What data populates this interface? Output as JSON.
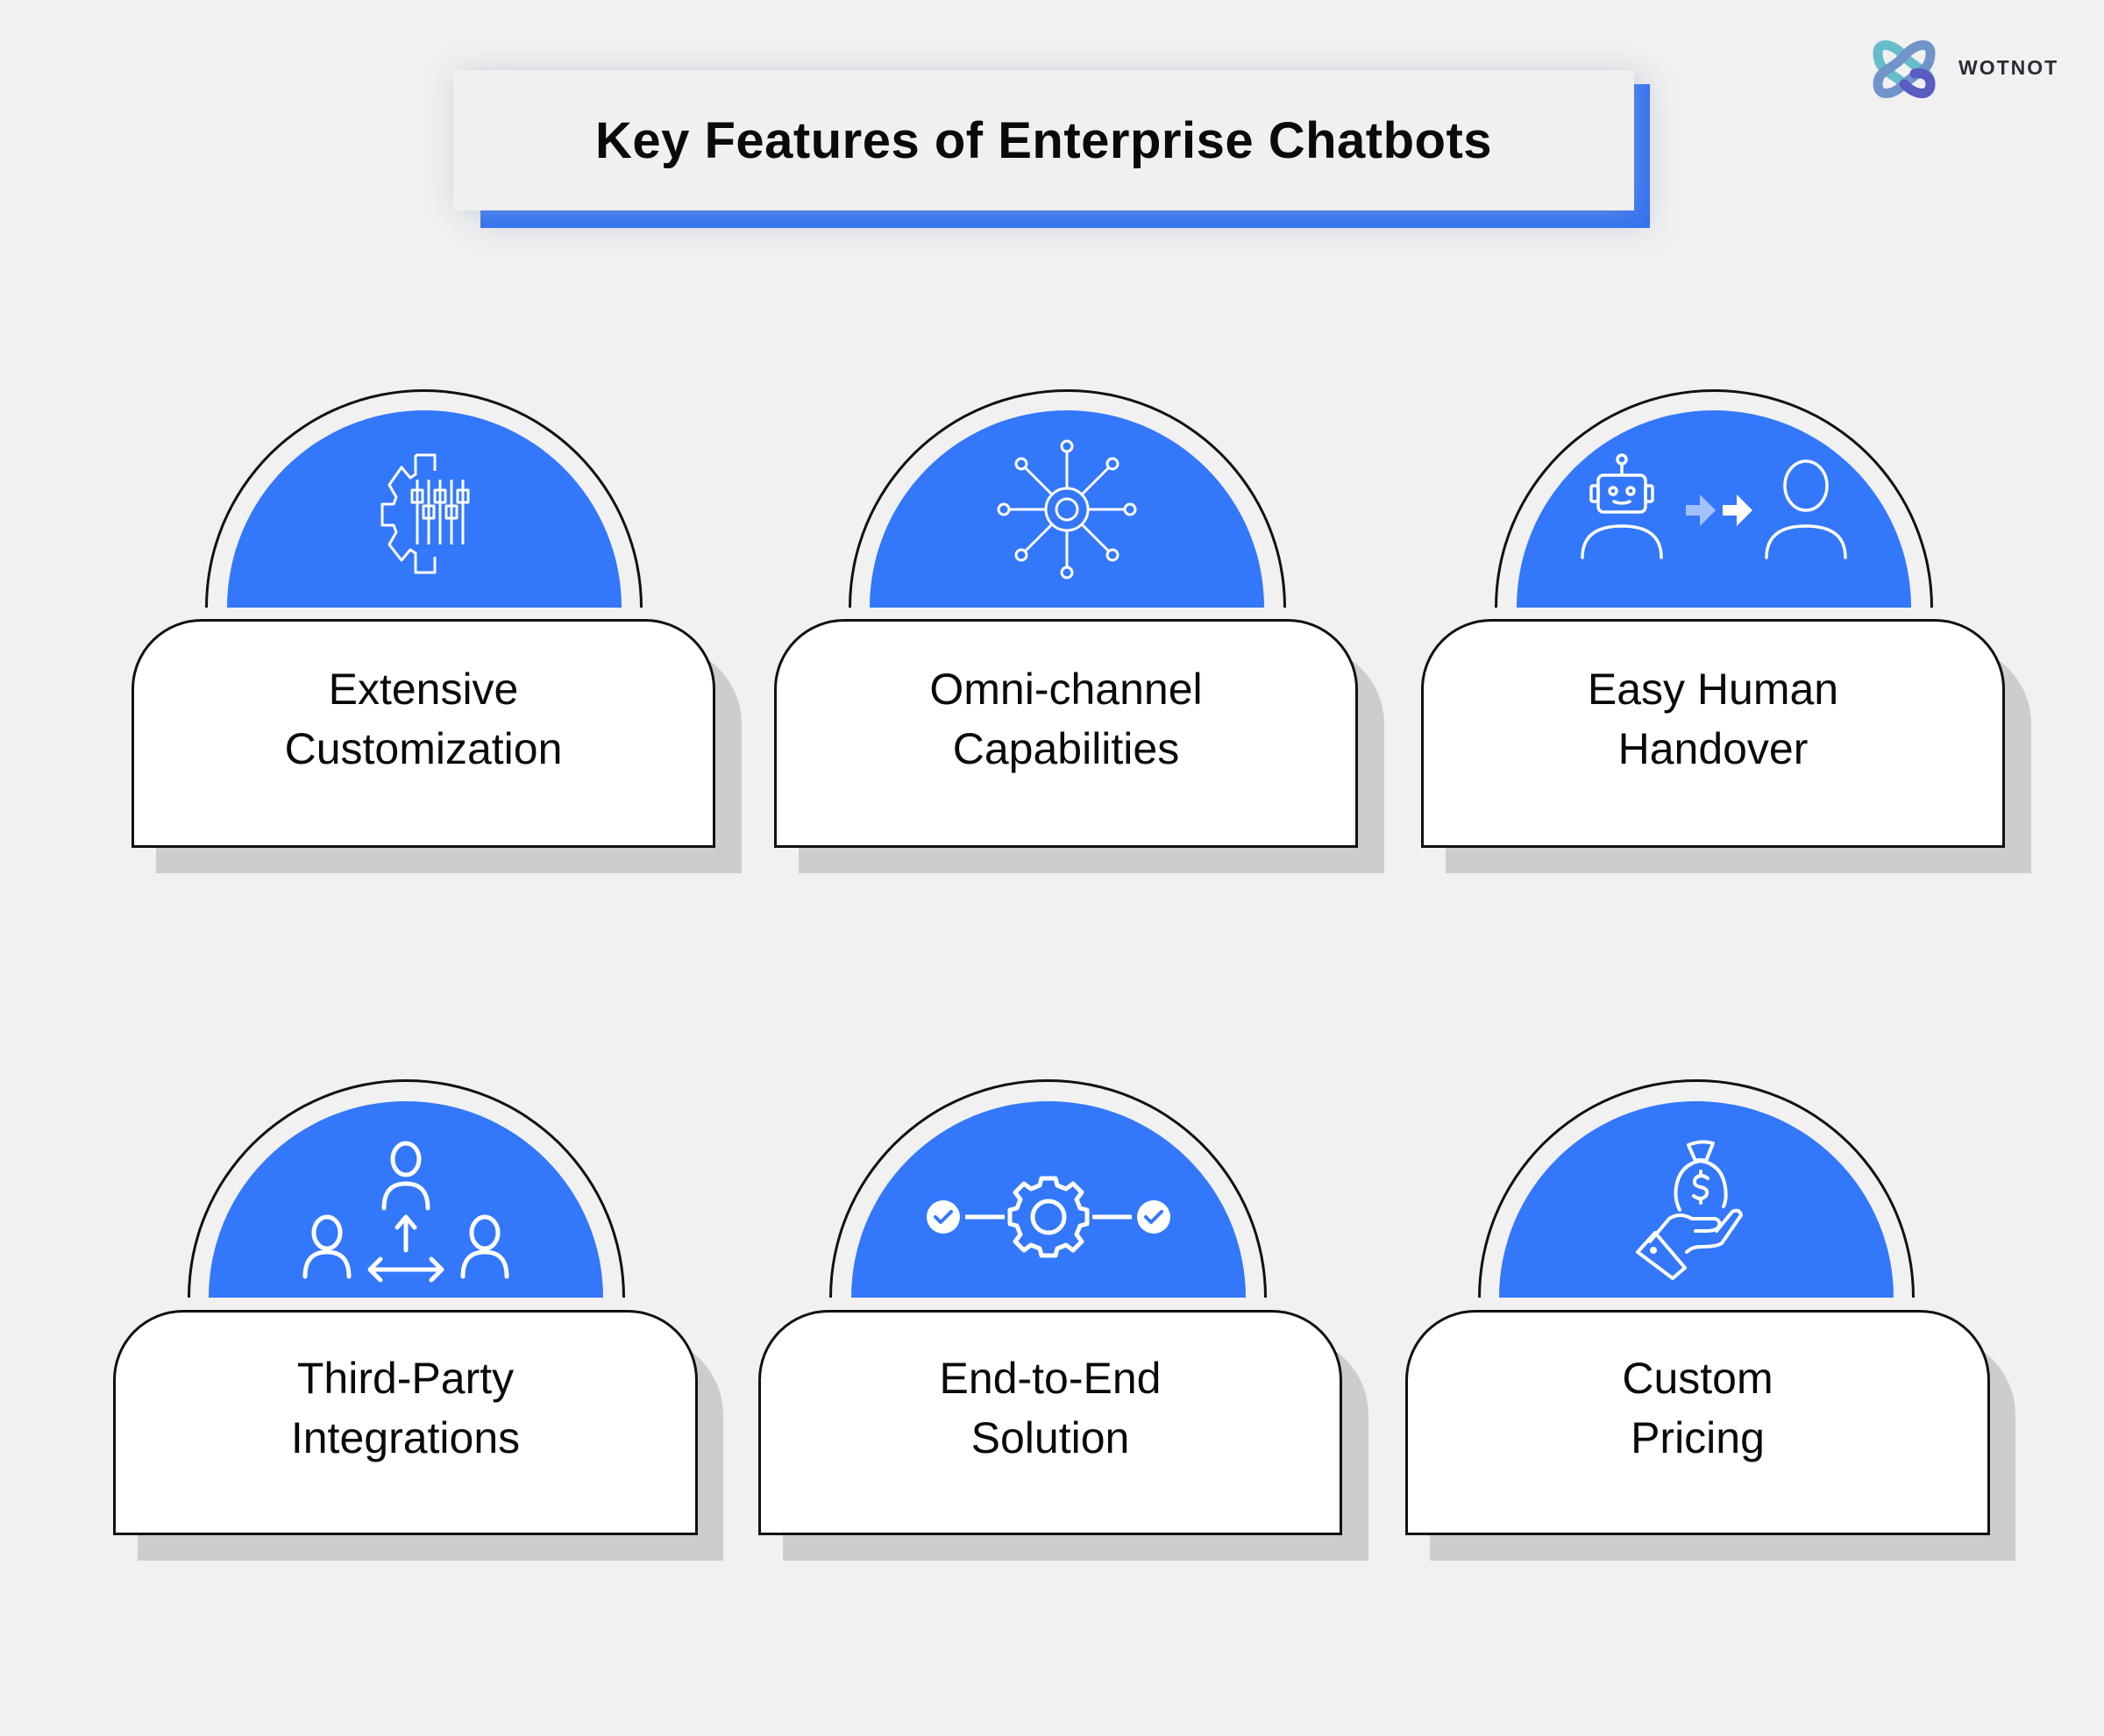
{
  "header": {
    "title": "Key Features of Enterprise Chatbots"
  },
  "brand": {
    "name": "WOTNOT",
    "logo_icon": "infinity-knot-logo-icon"
  },
  "colors": {
    "accent_blue": "#3377fb",
    "background": "#f1f1f1",
    "card": "#ffffff",
    "card_shadow": "#cdcdcd",
    "outline": "#111111"
  },
  "features": [
    {
      "line1": "Extensive",
      "line2": "Customization",
      "icon": "gear-sliders-icon"
    },
    {
      "line1": "Omni-channel",
      "line2": "Capabilities",
      "icon": "network-hub-icon"
    },
    {
      "line1": "Easy Human",
      "line2": "Handover",
      "icon": "bot-to-human-icon"
    },
    {
      "line1": "Third-Party",
      "line2": "Integrations",
      "icon": "people-connections-icon"
    },
    {
      "line1": "End-to-End",
      "line2": "Solution",
      "icon": "process-gear-checks-icon"
    },
    {
      "line1": "Custom",
      "line2": "Pricing",
      "icon": "money-bag-hand-icon"
    }
  ]
}
